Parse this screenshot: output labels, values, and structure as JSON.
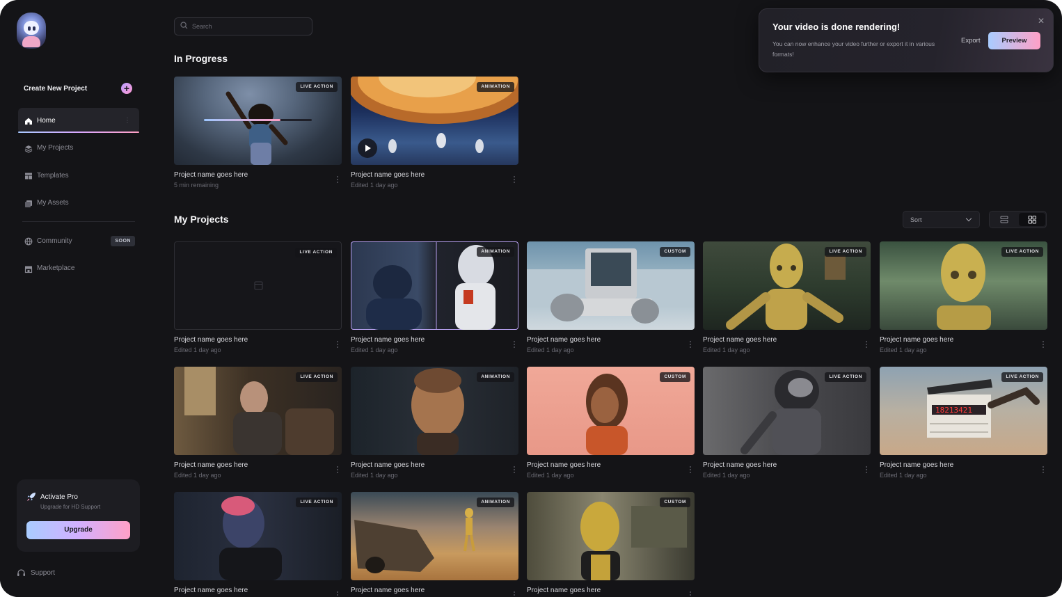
{
  "sidebar": {
    "create_label": "Create New Project",
    "items": [
      {
        "label": "Home",
        "active": true
      },
      {
        "label": "My Projects"
      },
      {
        "label": "Templates"
      },
      {
        "label": "My Assets"
      }
    ],
    "community": {
      "label": "Community",
      "badge": "SOON"
    },
    "marketplace": {
      "label": "Marketplace"
    },
    "pro": {
      "title": "Activate Pro",
      "subtitle": "Upgrade for HD Support",
      "button": "Upgrade"
    },
    "support": "Support"
  },
  "search": {
    "placeholder": "Search"
  },
  "in_progress": {
    "title": "In Progress",
    "cards": [
      {
        "tag": "LIVE ACTION",
        "name": "Project name goes here",
        "meta": "5 min remaining",
        "progress": 0.71
      },
      {
        "tag": "ANIMATION",
        "name": "Project name goes here",
        "meta": "Edited 1 day ago"
      }
    ]
  },
  "my_projects": {
    "title": "My Projects",
    "sort_label": "Sort",
    "cards": [
      {
        "tag": "LIVE ACTION",
        "name": "Project name goes here",
        "meta": "Edited 1 day ago"
      },
      {
        "tag": "ANIMATION",
        "name": "Project name goes here",
        "meta": "Edited 1 day ago"
      },
      {
        "tag": "CUSTOM",
        "name": "Project name goes here",
        "meta": "Edited 1 day ago"
      },
      {
        "tag": "LIVE ACTION",
        "name": "Project name goes here",
        "meta": "Edited 1 day ago"
      },
      {
        "tag": "LIVE ACTION",
        "name": "Project name goes here",
        "meta": "Edited 1 day ago"
      },
      {
        "tag": "LIVE ACTION",
        "name": "Project name goes here",
        "meta": "Edited 1 day ago"
      },
      {
        "tag": "ANIMATION",
        "name": "Project name goes here",
        "meta": "Edited 1 day ago"
      },
      {
        "tag": "CUSTOM",
        "name": "Project name goes here",
        "meta": "Edited 1 day ago"
      },
      {
        "tag": "LIVE ACTION",
        "name": "Project name goes here",
        "meta": "Edited 1 day ago"
      },
      {
        "tag": "LIVE ACTION",
        "name": "Project name goes here",
        "meta": "Edited 1 day ago"
      },
      {
        "tag": "LIVE ACTION",
        "name": "Project name goes here",
        "meta": ""
      },
      {
        "tag": "ANIMATION",
        "name": "Project name goes here",
        "meta": ""
      },
      {
        "tag": "CUSTOM",
        "name": "Project name goes here",
        "meta": ""
      }
    ]
  },
  "toast": {
    "title": "Your video is done rendering!",
    "body": "You can now enhance your video further or export it in various formats!",
    "export": "Export",
    "preview": "Preview"
  },
  "colors": {
    "accent_start": "#a9ccff",
    "accent_end": "#ffa0c6",
    "background": "#141417"
  }
}
